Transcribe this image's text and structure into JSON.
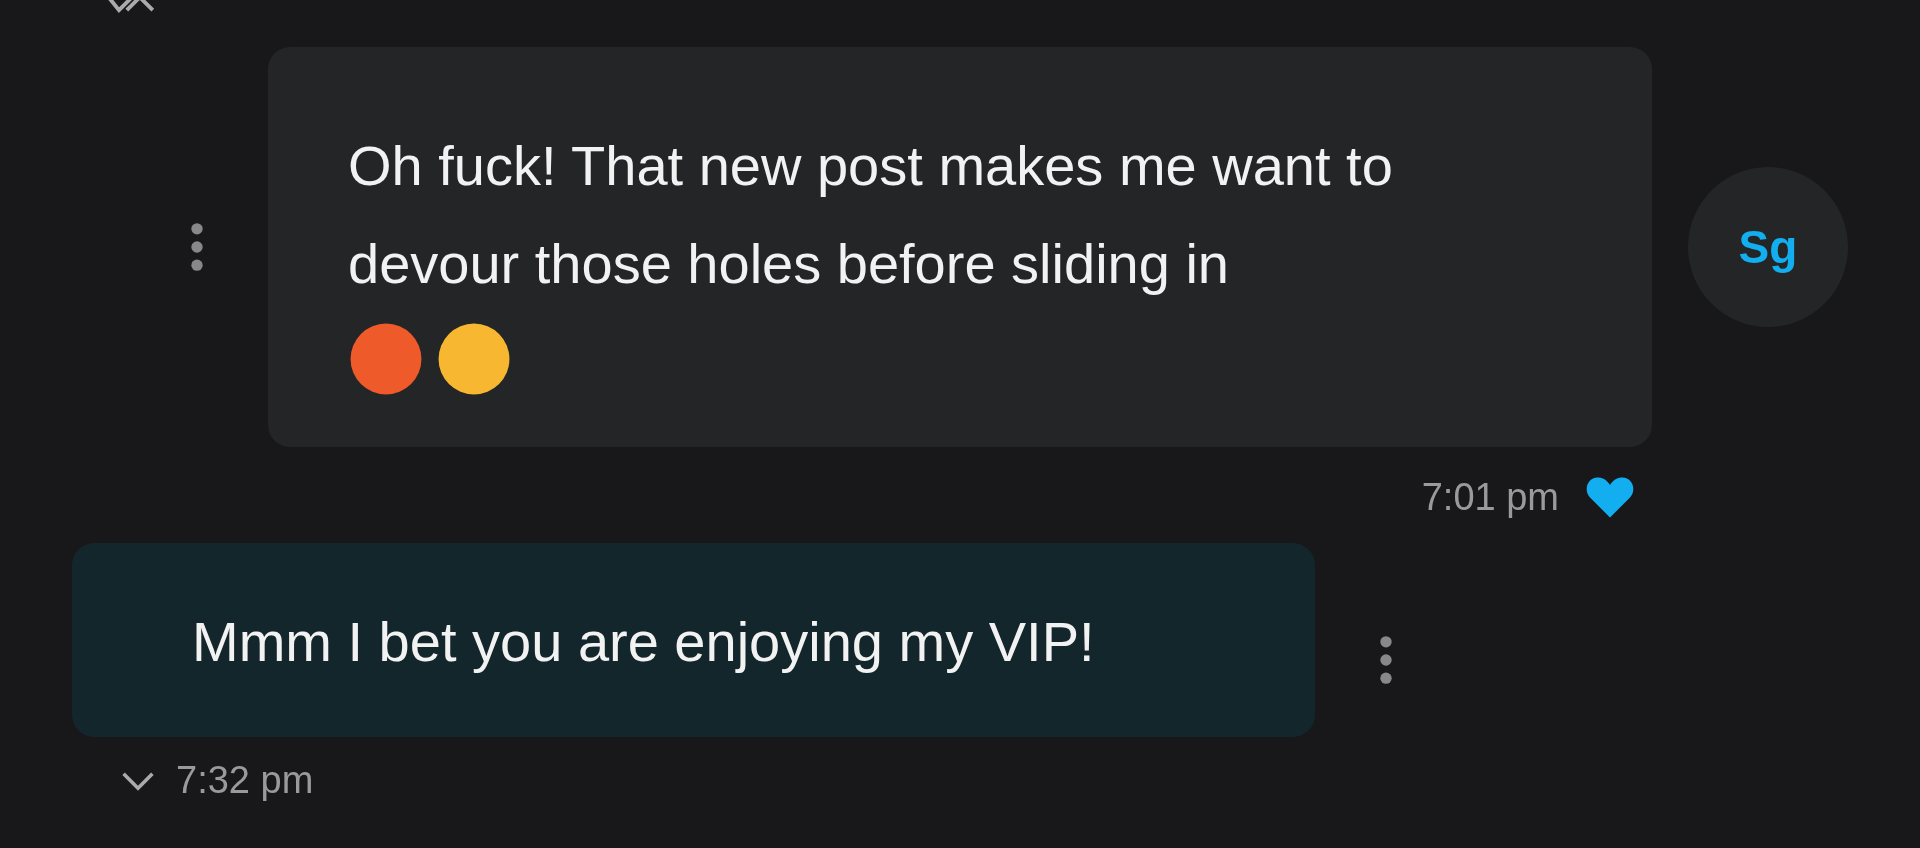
{
  "messages": [
    {
      "kind": "received",
      "text": "Oh fuck! That new post makes me want to devour those holes before sliding in",
      "emojis": [
        {
          "kind": "hot"
        },
        {
          "kind": "weary"
        }
      ],
      "avatar": "Sg",
      "time": "7:01 pm",
      "liked": true
    },
    {
      "kind": "sent",
      "text": "Mmm I bet you are enjoying my VIP!",
      "time": "7:32 pm"
    }
  ]
}
